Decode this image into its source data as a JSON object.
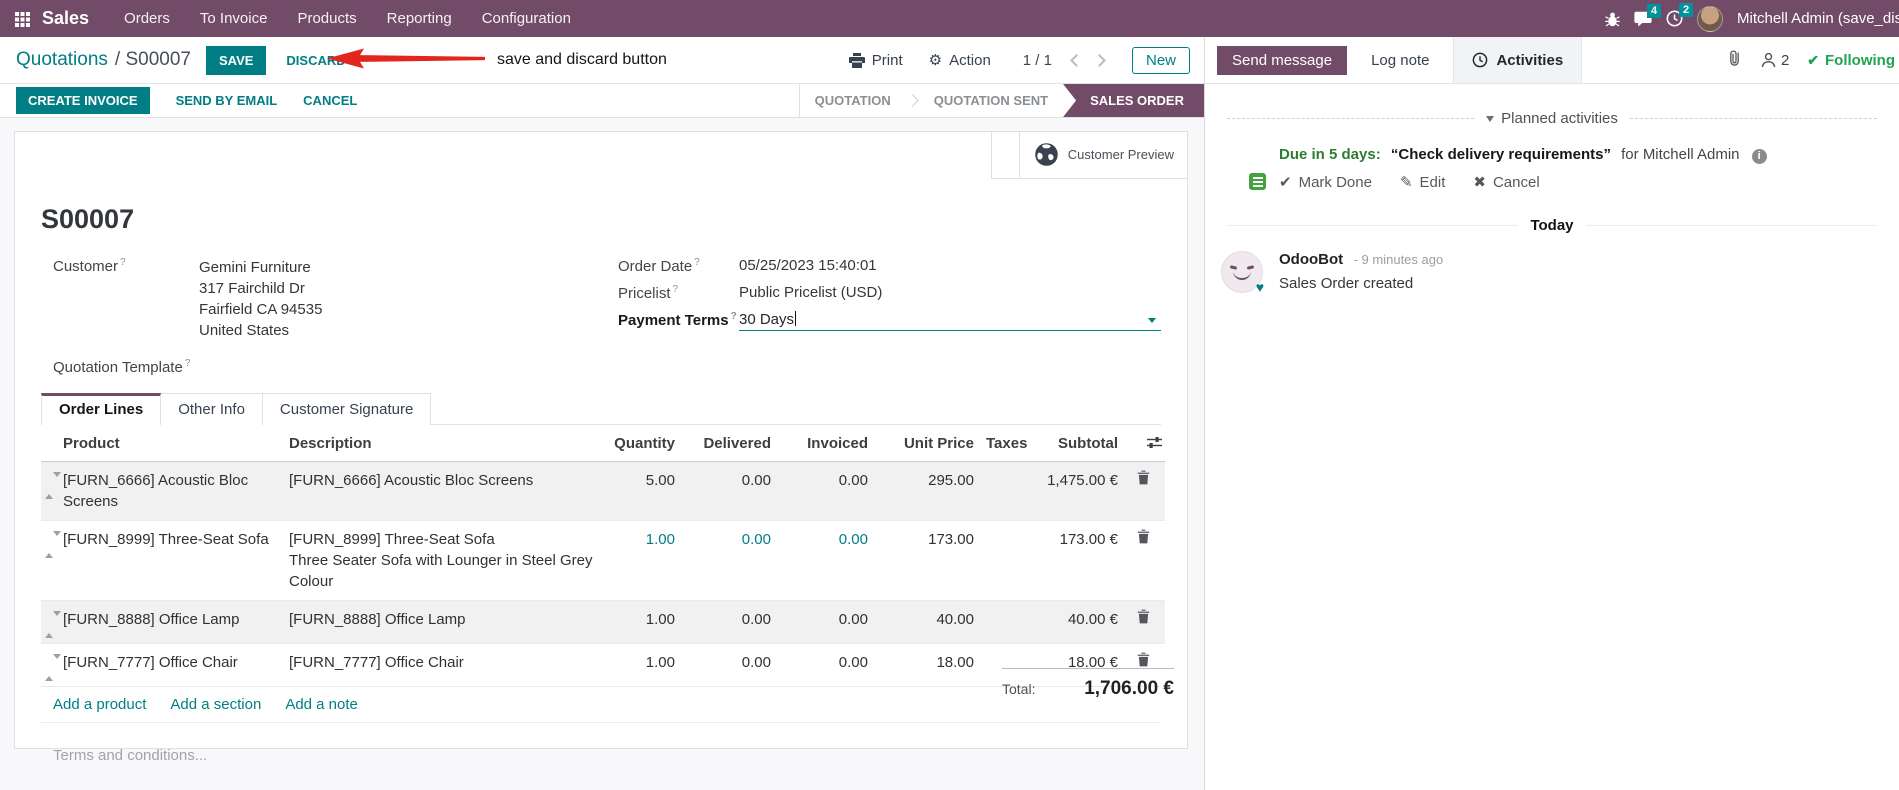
{
  "colors": {
    "brand": "#714B67",
    "accent": "#017E84",
    "annotation_red": "#E3261D",
    "success_green": "#21a350"
  },
  "icons": {
    "gear": "⚙",
    "check": "✔",
    "edit": "✎",
    "x": "✖",
    "heart": "♥",
    "question": "?",
    "info": "i"
  },
  "nav": {
    "app_name": "Sales",
    "items": [
      "Orders",
      "To Invoice",
      "Products",
      "Reporting",
      "Configuration"
    ],
    "messages_badge": "4",
    "activities_badge": "2",
    "user_name": "Mitchell Admin (save_discar"
  },
  "control_panel": {
    "breadcrumb_parent": "Quotations",
    "breadcrumb_current": "/ S00007",
    "save_label": "SAVE",
    "discard_label": "DISCARD",
    "annotation_text": "save and discard button",
    "print_label": "Print",
    "action_label": "Action",
    "pager": "1 / 1",
    "new_label": "New"
  },
  "statusbar": {
    "create_invoice_label": "CREATE INVOICE",
    "send_by_email_label": "SEND BY EMAIL",
    "cancel_label": "CANCEL",
    "stages": [
      "QUOTATION",
      "QUOTATION SENT",
      "SALES ORDER"
    ],
    "active_stage": "SALES ORDER"
  },
  "form": {
    "customer_preview_label": "Customer Preview",
    "title": "S00007",
    "fields": {
      "customer_label": "Customer",
      "customer_value": "Gemini Furniture",
      "address_line1": "317 Fairchild Dr",
      "address_line2": "Fairfield CA 94535",
      "address_line3": "United States",
      "quotation_template_label": "Quotation Template",
      "order_date_label": "Order Date",
      "order_date_value": "05/25/2023 15:40:01",
      "pricelist_label": "Pricelist",
      "pricelist_value": "Public Pricelist (USD)",
      "payment_terms_label": "Payment Terms",
      "payment_terms_value": "30 Days"
    },
    "tabs": [
      "Order Lines",
      "Other Info",
      "Customer Signature"
    ],
    "active_tab": "Order Lines",
    "table": {
      "headers": {
        "product": "Product",
        "description": "Description",
        "quantity": "Quantity",
        "delivered": "Delivered",
        "invoiced": "Invoiced",
        "unit_price": "Unit Price",
        "taxes": "Taxes",
        "subtotal": "Subtotal"
      },
      "rows": [
        {
          "product": "[FURN_6666] Acoustic Bloc Screens",
          "description": "[FURN_6666] Acoustic Bloc Screens",
          "description2": "",
          "quantity": "5.00",
          "delivered": "0.00",
          "invoiced": "0.00",
          "unit_price": "295.00",
          "taxes": "",
          "subtotal": "1,475.00 €"
        },
        {
          "product": "[FURN_8999] Three-Seat Sofa",
          "description": "[FURN_8999] Three-Seat Sofa",
          "description2": "Three Seater Sofa with Lounger in Steel Grey Colour",
          "quantity": "1.00",
          "delivered": "0.00",
          "invoiced": "0.00",
          "unit_price": "173.00",
          "taxes": "",
          "subtotal": "173.00 €"
        },
        {
          "product": "[FURN_8888] Office Lamp",
          "description": "[FURN_8888] Office Lamp",
          "description2": "",
          "quantity": "1.00",
          "delivered": "0.00",
          "invoiced": "0.00",
          "unit_price": "40.00",
          "taxes": "",
          "subtotal": "40.00 €"
        },
        {
          "product": "[FURN_7777] Office Chair",
          "description": "[FURN_7777] Office Chair",
          "description2": "",
          "quantity": "1.00",
          "delivered": "0.00",
          "invoiced": "0.00",
          "unit_price": "18.00",
          "taxes": "",
          "subtotal": "18.00 €"
        }
      ],
      "footer_links": [
        "Add a product",
        "Add a section",
        "Add a note"
      ]
    },
    "terms_placeholder": "Terms and conditions...",
    "total_label": "Total:",
    "total_value": "1,706.00 €"
  },
  "chatter": {
    "send_message_label": "Send message",
    "log_note_label": "Log note",
    "activities_label": "Activities",
    "followers_count": "2",
    "following_label": "Following",
    "planned_header": "Planned activities",
    "activity": {
      "due": "Due in 5 days:",
      "summary": "“Check delivery requirements”",
      "for_text": "for Mitchell Admin",
      "mark_done_label": "Mark Done",
      "edit_label": "Edit",
      "cancel_label": "Cancel"
    },
    "today_label": "Today",
    "message": {
      "author": "OdooBot",
      "time": "- 9 minutes ago",
      "body": "Sales Order created"
    }
  }
}
